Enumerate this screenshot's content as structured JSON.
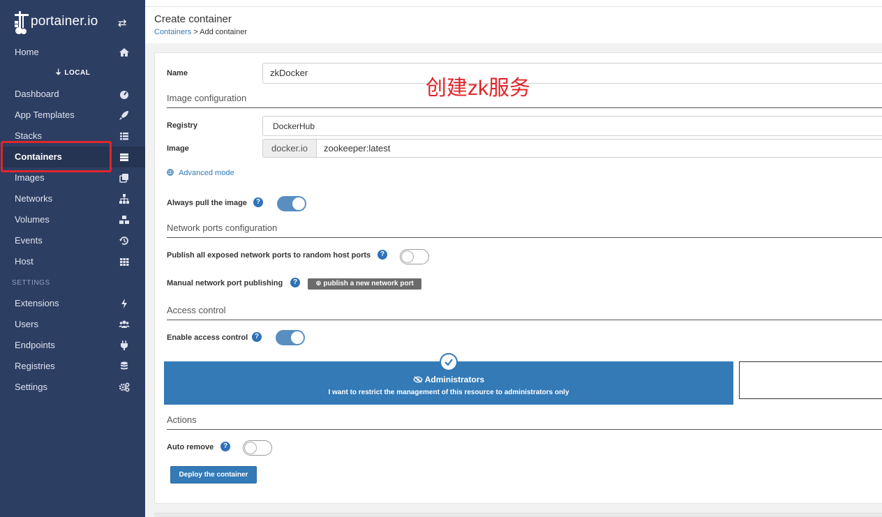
{
  "sidebar": {
    "logo_text": "portainer.io",
    "endpoint_label": "LOCAL",
    "settings_header": "SETTINGS",
    "items": [
      {
        "label": "Home",
        "icon": "home-icon"
      },
      {
        "label": "Dashboard",
        "icon": "dashboard-icon"
      },
      {
        "label": "App Templates",
        "icon": "rocket-icon"
      },
      {
        "label": "Stacks",
        "icon": "th-list-icon"
      },
      {
        "label": "Containers",
        "icon": "server-icon"
      },
      {
        "label": "Images",
        "icon": "clone-icon"
      },
      {
        "label": "Networks",
        "icon": "sitemap-icon"
      },
      {
        "label": "Volumes",
        "icon": "cubes-icon"
      },
      {
        "label": "Events",
        "icon": "history-icon"
      },
      {
        "label": "Host",
        "icon": "th-icon"
      },
      {
        "label": "Extensions",
        "icon": "bolt-icon"
      },
      {
        "label": "Users",
        "icon": "users-icon"
      },
      {
        "label": "Endpoints",
        "icon": "plug-icon"
      },
      {
        "label": "Registries",
        "icon": "database-icon"
      },
      {
        "label": "Settings",
        "icon": "cogs-icon"
      }
    ]
  },
  "header": {
    "title": "Create container",
    "breadcrumb_link": "Containers",
    "breadcrumb_sep": " > ",
    "breadcrumb_current": "Add container"
  },
  "form": {
    "name_label": "Name",
    "name_value": "zkDocker",
    "image_section": "Image configuration",
    "registry_label": "Registry",
    "registry_value": "DockerHub",
    "image_label": "Image",
    "image_prefix": "docker.io",
    "image_value": "zookeeper:latest",
    "advanced_mode": "Advanced mode",
    "always_pull_label": "Always pull the image",
    "always_pull": true,
    "ports_section": "Network ports configuration",
    "publish_all_label": "Publish all exposed network ports to random host ports",
    "publish_all": false,
    "manual_ports_label": "Manual network port publishing",
    "publish_new_port_button": "publish a new network port",
    "access_section": "Access control",
    "enable_access_label": "Enable access control",
    "enable_access": true,
    "admin_title": "Administrators",
    "admin_desc": "I want to restrict the management of this resource to administrators only",
    "actions_section": "Actions",
    "auto_remove_label": "Auto remove",
    "auto_remove": false,
    "deploy_button": "Deploy the container",
    "help_glyph": "?"
  },
  "annotation": "创建zk服务",
  "colors": {
    "sidebar_bg": "#2d3e63",
    "primary": "#337ab7",
    "highlight_red": "#e0262a"
  }
}
